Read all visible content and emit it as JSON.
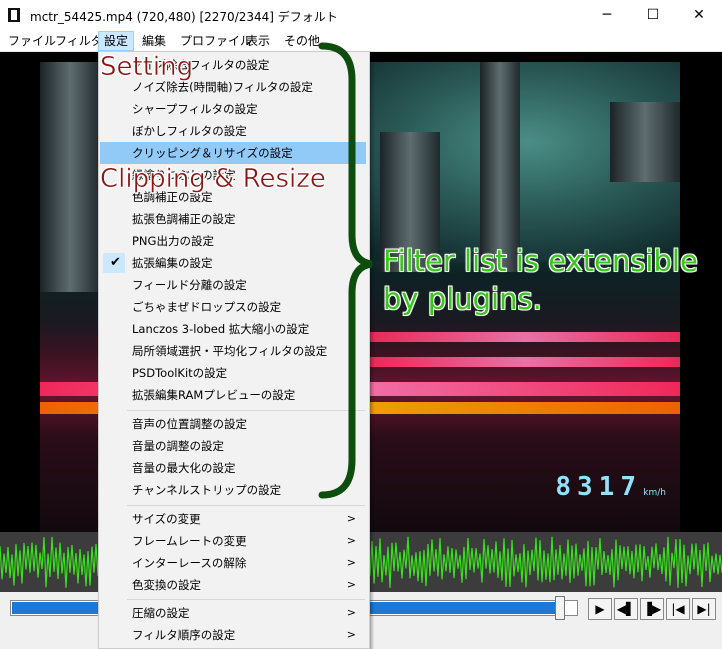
{
  "window": {
    "title": "mctr_54425.mp4 (720,480)  [2270/2344]  デフォルト",
    "minimize": "─",
    "maximize": "☐",
    "close": "✕"
  },
  "menubar": [
    "ファイル",
    "フィルタ",
    "設定",
    "編集",
    "プロファイル",
    "表示",
    "その他"
  ],
  "dropdown": {
    "items": [
      {
        "label": "ノイズ除去フィルタの設定"
      },
      {
        "label": "ノイズ除去(時間軸)フィルタの設定"
      },
      {
        "label": "シャープフィルタの設定"
      },
      {
        "label": "ぼかしフィルタの設定"
      },
      {
        "label": "クリッピング＆リサイズの設定",
        "state": "hover"
      },
      {
        "label": "縁塗りつぶしの設定"
      },
      {
        "label": "色調補正の設定"
      },
      {
        "label": "拡張色調補正の設定"
      },
      {
        "label": "PNG出力の設定"
      },
      {
        "label": "拡張編集の設定",
        "checked": true
      },
      {
        "label": "フィールド分離の設定"
      },
      {
        "label": "ごちゃまぜドロップスの設定"
      },
      {
        "label": "Lanczos 3-lobed 拡大縮小の設定"
      },
      {
        "label": "局所領域選択・平均化フィルタの設定"
      },
      {
        "label": "PSDToolKitの設定"
      },
      {
        "label": "拡張編集RAMプレビューの設定"
      },
      {
        "label": "音声の位置調整の設定"
      },
      {
        "label": "音量の調整の設定"
      },
      {
        "label": "音量の最大化の設定"
      },
      {
        "label": "チャンネルストリップの設定"
      },
      {
        "label": "サイズの変更",
        "submenu": true
      },
      {
        "label": "フレームレートの変更",
        "submenu": true
      },
      {
        "label": "インターレースの解除",
        "submenu": true
      },
      {
        "label": "色変換の設定",
        "submenu": true
      },
      {
        "label": "圧縮の設定",
        "submenu": true
      },
      {
        "label": "フィルタ順序の設定",
        "submenu": true
      }
    ]
  },
  "video": {
    "speed": "8317",
    "speed_unit": "km/h"
  },
  "seek": {
    "position_fraction": 0.969
  },
  "controls": [
    "▶",
    "◀▌",
    "▐▶",
    "|◀",
    "▶|"
  ],
  "annotations": {
    "setting": "Setting",
    "clipping": "Clipping & Resize",
    "filter_line1": "Filter list is extensible",
    "filter_line2": "by plugins."
  },
  "colors": {
    "annotation_red": "#8b1515",
    "annotation_green": "#39c61c",
    "brace": "#0e4d0e",
    "waveform": "#39e01c",
    "hover": "#91c9f7"
  }
}
